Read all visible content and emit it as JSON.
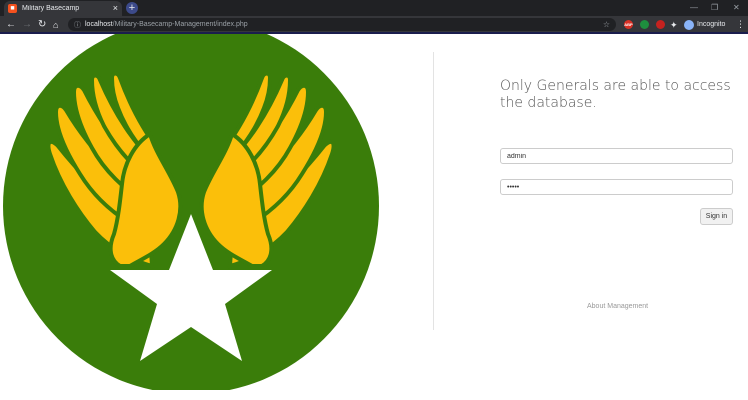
{
  "browser": {
    "tab_title": "Military Basecamp",
    "tab_favicon": "MB",
    "url_host": "localhost",
    "url_path": "/Military-Basecamp-Management/index.php",
    "incognito_label": "Incognito",
    "extensions": [
      "ABP",
      "",
      ""
    ]
  },
  "colors": {
    "emblem_green": "#3a7d0a",
    "wing_yellow": "#fbbf0a",
    "star_white": "#ffffff"
  },
  "login": {
    "heading": "Only Generals are able to access the database.",
    "username_value": "admin",
    "password_value": "•••••",
    "signin_label": "Sign in",
    "about_link": "About Management"
  }
}
